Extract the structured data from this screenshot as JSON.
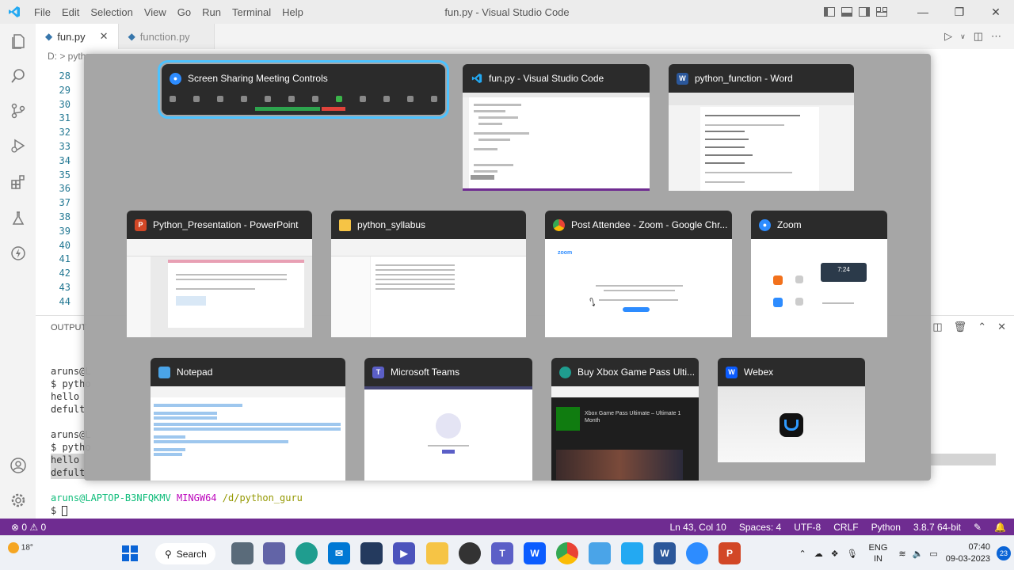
{
  "window": {
    "title": "fun.py - Visual Studio Code",
    "menu": [
      "File",
      "Edit",
      "Selection",
      "View",
      "Go",
      "Run",
      "Terminal",
      "Help"
    ]
  },
  "tabs": [
    {
      "label": "fun.py",
      "active": true
    },
    {
      "label": "function.py",
      "active": false
    }
  ],
  "breadcrumb": "D: > pyth",
  "line_numbers": [
    "28",
    "29",
    "30",
    "31",
    "32",
    "33",
    "34",
    "35",
    "36",
    "37",
    "38",
    "39",
    "40",
    "41",
    "42",
    "43",
    "44"
  ],
  "panel": {
    "label": "OUTPUT"
  },
  "terminal": {
    "l1": "aruns@L",
    "l2": "$ pytho",
    "l3": "hello",
    "l4": "defult",
    "l5": "aruns@L",
    "l6": "$ pytho",
    "l7": "hello",
    "l8": "defult",
    "prompt_user": "aruns@LAPTOP-B3NFQKMV",
    "prompt_env": "MINGW64",
    "prompt_path": "/d/python_guru",
    "prompt_symbol": "$"
  },
  "statusbar": {
    "problems": "⊗ 0 ⚠ 0",
    "position": "Ln 43, Col 10",
    "spaces": "Spaces: 4",
    "encoding": "UTF-8",
    "eol": "CRLF",
    "language": "Python",
    "interpreter": "3.8.7 64-bit"
  },
  "switcher": {
    "cards": [
      {
        "title": "Screen Sharing Meeting Controls",
        "icon": "zoom-icon",
        "color": "#2d8cff"
      },
      {
        "title": "fun.py - Visual Studio Code",
        "icon": "vscode-icon",
        "color": "#23a9f2"
      },
      {
        "title": "python_function - Word",
        "icon": "word-icon",
        "color": "#2b579a"
      },
      {
        "title": "Python_Presentation - PowerPoint",
        "icon": "powerpoint-icon",
        "color": "#d24726"
      },
      {
        "title": "python_syllabus",
        "icon": "folder-icon",
        "color": "#f6c445"
      },
      {
        "title": "Post Attendee - Zoom - Google Chr...",
        "icon": "chrome-icon",
        "color": "#34a853"
      },
      {
        "title": "Zoom",
        "icon": "zoom-icon",
        "color": "#2d8cff"
      },
      {
        "title": "Notepad",
        "icon": "notepad-icon",
        "color": "#4aa4e8"
      },
      {
        "title": "Microsoft Teams",
        "icon": "teams-icon",
        "color": "#5b5fc7"
      },
      {
        "title": "Buy Xbox Game Pass Ulti...",
        "icon": "edge-icon",
        "color": "#1f9d8f"
      },
      {
        "title": "Webex",
        "icon": "webex-icon",
        "color": "#0b5cff"
      }
    ],
    "zoom_time": "7:24",
    "xbox_heading": "Xbox Game Pass Ultimate – Ultimate 1 Month",
    "zoom_logo": "zoom"
  },
  "taskbar": {
    "weather": "18°",
    "search": "Search",
    "lang1": "ENG",
    "lang2": "IN",
    "time": "07:40",
    "date": "09-03-2023",
    "notifications": "23"
  }
}
